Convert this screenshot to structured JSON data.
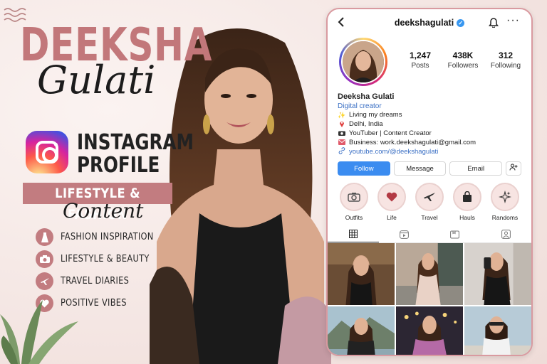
{
  "promo": {
    "name_block": "DEEKSHA",
    "name_script": "Gulati",
    "platform_line1": "INSTAGRAM",
    "platform_line2": "PROFILE",
    "ribbon": "LIFESTYLE & FASHION",
    "ribbon_script": "Content",
    "features": [
      {
        "icon": "dress-icon",
        "label": "FASHION INSPIRATION"
      },
      {
        "icon": "camera-icon",
        "label": "LIFESTYLE & BEAUTY"
      },
      {
        "icon": "plane-icon",
        "label": "TRAVEL DIARIES"
      },
      {
        "icon": "heart-icon",
        "label": "POSITIVE VIBES"
      }
    ],
    "accent_color": "#c27c80"
  },
  "profile": {
    "username": "deekshagulati",
    "display_name": "Deeksha Gulati",
    "category": "Digital creator",
    "stats": [
      {
        "value": "1,247",
        "label": "Posts"
      },
      {
        "value": "438K",
        "label": "Followers"
      },
      {
        "value": "312",
        "label": "Following"
      }
    ],
    "bio": [
      {
        "icon": "sparkles-icon",
        "text": "Living my dreams"
      },
      {
        "icon": "pin-icon",
        "text": "Delhi, India"
      },
      {
        "icon": "camera-icon",
        "text": "YouTuber | Content Creator"
      },
      {
        "icon": "mail-icon",
        "text": "Business: work.deekshagulati@gmail.com"
      }
    ],
    "link": "youtube.com/@deekshagulati",
    "buttons": {
      "follow": "Follow",
      "message": "Message",
      "email": "Email"
    },
    "highlights": [
      {
        "icon": "camera-icon",
        "label": "Outfits"
      },
      {
        "icon": "heart-icon",
        "label": "Life"
      },
      {
        "icon": "plane-icon",
        "label": "Travel"
      },
      {
        "icon": "bag-icon",
        "label": "Hauls"
      },
      {
        "icon": "sparkles-icon",
        "label": "Randoms"
      }
    ],
    "verified_color": "#3897f0",
    "follow_color": "#3b8cf0"
  }
}
